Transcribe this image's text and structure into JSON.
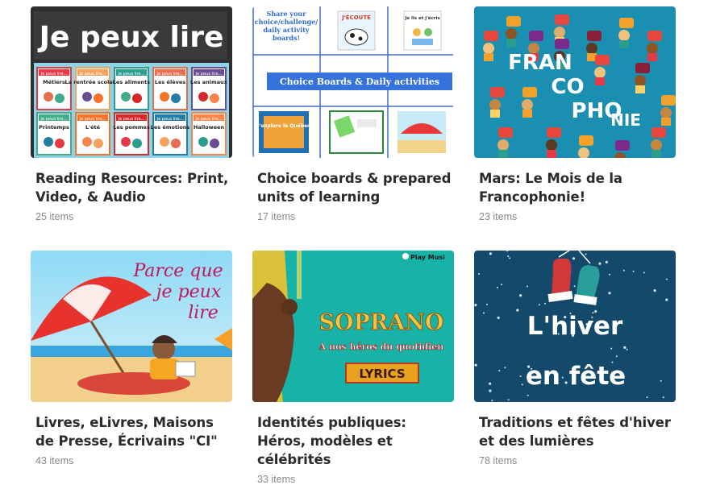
{
  "collections": [
    {
      "title": "Reading Resources: Print, Video, & Audio",
      "count": "25 items",
      "thumb": {
        "heading": "Je peux lire",
        "books": [
          "Métiers",
          "La rentrée scolaire",
          "Les aliments",
          "Les élèves",
          "Les animaux",
          "Printemps",
          "L'été",
          "Les pommes",
          "Les émotions",
          "Halloween"
        ],
        "book_tag": "Je peux lire..."
      }
    },
    {
      "title": "Choice boards & prepared units of learning",
      "count": "17 items",
      "thumb": {
        "note": "Share your choice/challenge/ daily activity boards!",
        "banner": "Choice Boards & Daily activities",
        "badge1": "J'ÉCOUTE",
        "badge2": "Je lis et j'écris",
        "badge3": "J'explore le Québec"
      }
    },
    {
      "title": "Mars: Le Mois de la Francophonie!",
      "count": "23 items",
      "thumb": {
        "line1": "FRAN",
        "line2": "CO",
        "line3": "PHO",
        "line4": "NIE"
      }
    },
    {
      "title": "Livres, eLivres, Maisons de Presse, Écrivains \"CI\"",
      "count": "43 items",
      "thumb": {
        "line1": "Parce que",
        "line2": "je peux",
        "line3": "lire"
      }
    },
    {
      "title": "Identités publiques: Héros, modèles et célébrités",
      "count": "33 items",
      "thumb": {
        "corner": "Play Musi",
        "word": "SOPRANO",
        "sub": "A nos héros du quotidien",
        "tag": "LYRICS"
      }
    },
    {
      "title": "Traditions et fêtes d'hiver et des lumières",
      "count": "78 items",
      "thumb": {
        "line1": "L'hiver",
        "line2": "en fête"
      }
    }
  ]
}
